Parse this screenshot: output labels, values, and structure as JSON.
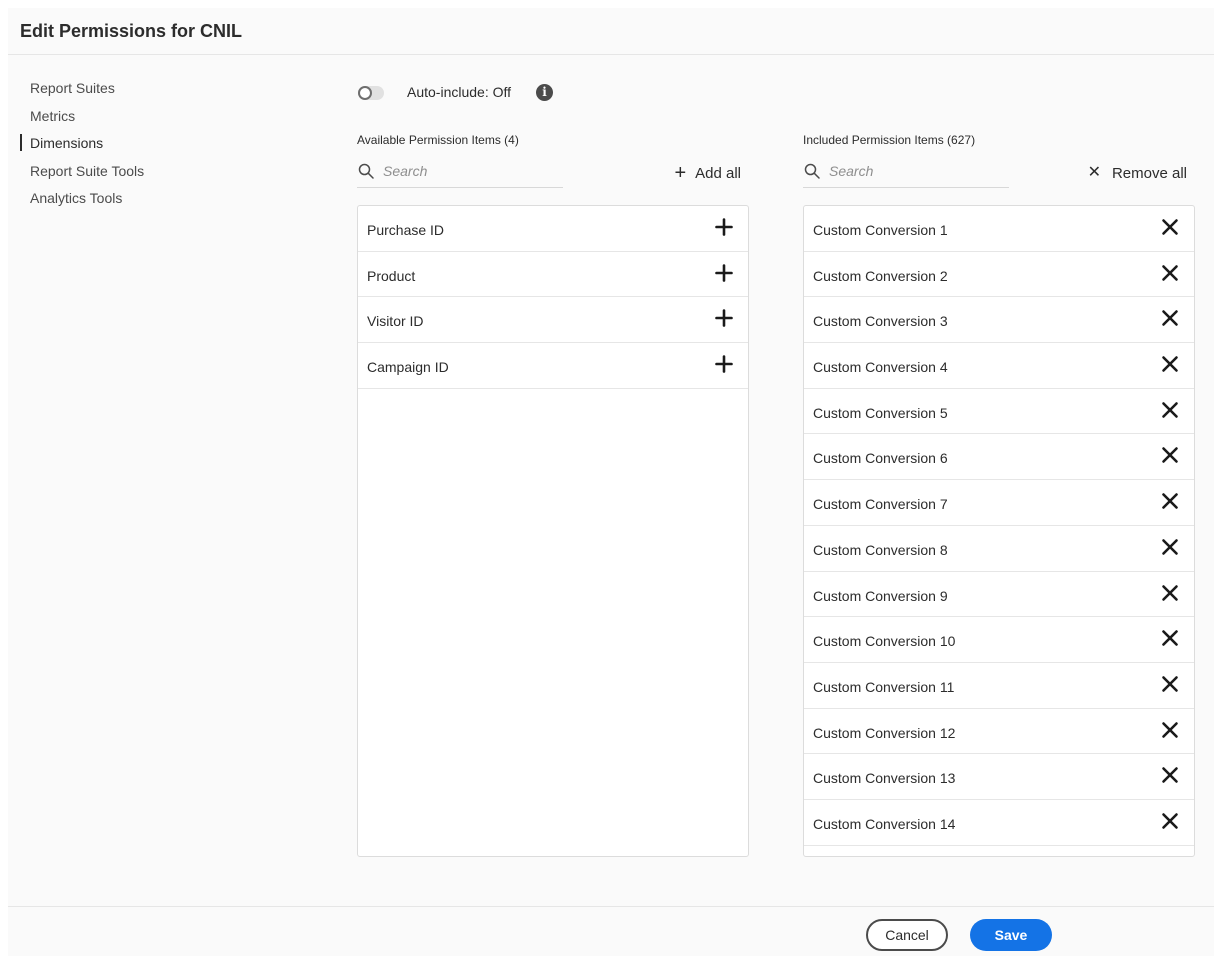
{
  "header": {
    "title": "Edit Permissions for CNIL"
  },
  "nav": {
    "items": [
      {
        "label": "Report Suites",
        "active": false
      },
      {
        "label": "Metrics",
        "active": false
      },
      {
        "label": "Dimensions",
        "active": true
      },
      {
        "label": "Report Suite Tools",
        "active": false
      },
      {
        "label": "Analytics Tools",
        "active": false
      }
    ]
  },
  "auto_include": {
    "label": "Auto-include: Off",
    "on": false,
    "info_icon": "info-icon"
  },
  "available": {
    "title": "Available Permission Items (4)",
    "search_placeholder": "Search",
    "add_all_label": "Add all",
    "items": [
      "Purchase ID",
      "Product",
      "Visitor ID",
      "Campaign ID"
    ],
    "item_icon": "plus-icon"
  },
  "included": {
    "title": "Included Permission Items (627)",
    "search_placeholder": "Search",
    "remove_all_label": "Remove all",
    "items": [
      "Custom Conversion 1",
      "Custom Conversion 2",
      "Custom Conversion 3",
      "Custom Conversion 4",
      "Custom Conversion 5",
      "Custom Conversion 6",
      "Custom Conversion 7",
      "Custom Conversion 8",
      "Custom Conversion 9",
      "Custom Conversion 10",
      "Custom Conversion 11",
      "Custom Conversion 12",
      "Custom Conversion 13",
      "Custom Conversion 14"
    ],
    "item_icon": "close-icon"
  },
  "footer": {
    "cancel_label": "Cancel",
    "save_label": "Save"
  },
  "colors": {
    "accent": "#1473e6",
    "text": "#2c2c2c",
    "background": "#fafafa"
  }
}
